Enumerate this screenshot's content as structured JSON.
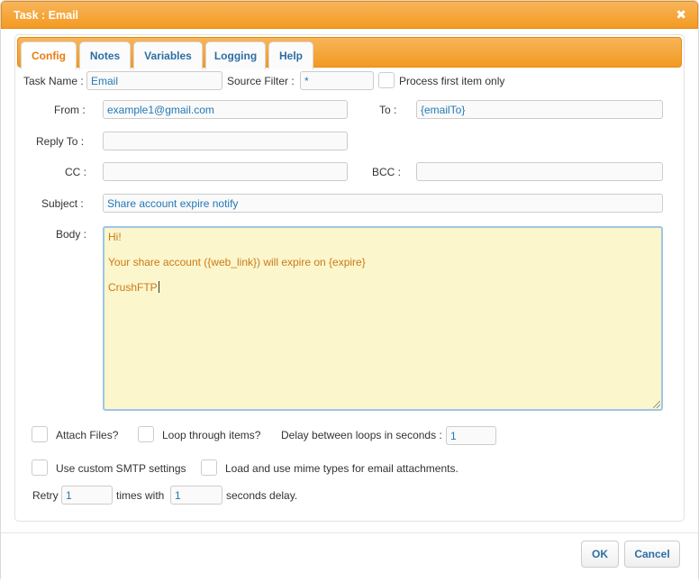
{
  "window": {
    "title": "Task : Email",
    "close_glyph": "✖"
  },
  "tabs": [
    {
      "label": "Config",
      "active": true
    },
    {
      "label": "Notes"
    },
    {
      "label": "Variables"
    },
    {
      "label": "Logging"
    },
    {
      "label": "Help"
    }
  ],
  "config": {
    "task_name_label": "Task Name :",
    "task_name_value": "Email",
    "source_filter_label": "Source Filter :",
    "source_filter_value": "*",
    "process_first_label": "Process first item only",
    "from_label": "From :",
    "from_value": "example1@gmail.com",
    "to_label": "To :",
    "to_value": "{emailTo}",
    "reply_to_label": "Reply To :",
    "reply_to_value": "",
    "cc_label": "CC :",
    "cc_value": "",
    "bcc_label": "BCC :",
    "bcc_value": "",
    "subject_label": "Subject :",
    "subject_value": "Share account expire notify",
    "body_label": "Body :",
    "body_lines": [
      "Hi!",
      "Your share account ({web_link}) will expire on {expire}",
      "CrushFTP"
    ],
    "attach_files_label": "Attach Files?",
    "loop_items_label": "Loop through items?",
    "delay_label": "Delay between loops in seconds :",
    "delay_value": "1",
    "custom_smtp_label": "Use custom SMTP settings",
    "mime_types_label": "Load and use mime types for email attachments.",
    "retry_label": "Retry",
    "retry_value": "1",
    "times_with_label": "times with",
    "seconds_value": "1",
    "seconds_delay_label": "seconds delay."
  },
  "buttons": {
    "ok": "OK",
    "cancel": "Cancel"
  },
  "colors": {
    "accent": "#f39a21",
    "link": "#2d6ea3",
    "body_bg": "#fcf6cc",
    "body_text": "#c97a1a"
  }
}
